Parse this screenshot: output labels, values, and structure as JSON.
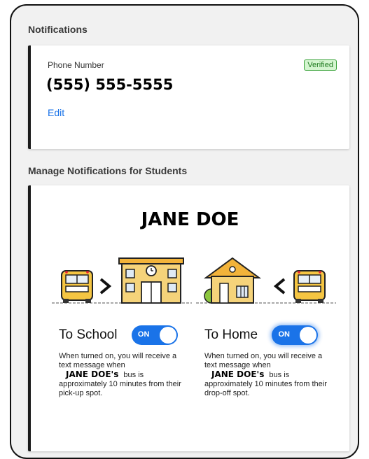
{
  "notifications": {
    "title": "Notifications",
    "phone_label": "Phone Number",
    "phone_number": "(555) 555-5555",
    "verified_badge": "Verified",
    "edit_link": "Edit"
  },
  "manage": {
    "title": "Manage Notifications for Students",
    "student_name": "JANE DOE",
    "to_school": {
      "label": "To School",
      "toggle": "ON",
      "desc_before": "When turned on, you will receive a text message when",
      "desc_name": "JANE DOE's",
      "desc_after": "bus is approximately 10 minutes from their pick-up spot."
    },
    "to_home": {
      "label": "To Home",
      "toggle": "ON",
      "desc_before": "When turned on, you will receive a text message when",
      "desc_name": "JANE DOE's",
      "desc_after": "bus is approximately 10 minutes from their drop-off spot."
    }
  },
  "colors": {
    "accent": "#1a73e8",
    "verified_bg": "#d4f5d0",
    "verified_text": "#1e7a1e"
  }
}
